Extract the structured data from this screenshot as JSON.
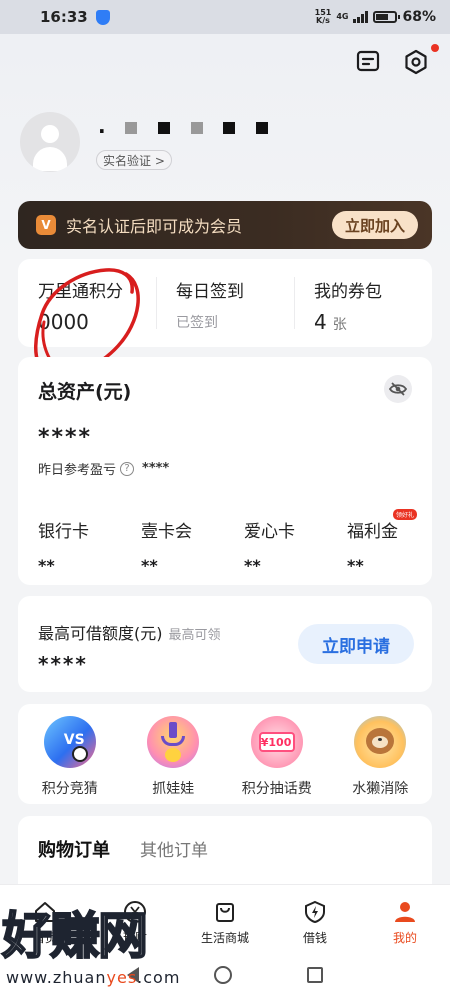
{
  "status_bar": {
    "time": "16:33",
    "net_speed": "151",
    "net_unit": "K/s",
    "net_type": "4G",
    "battery": "68%"
  },
  "header": {
    "username_masked": ". ·· . . ",
    "verify_label": "实名验证 >"
  },
  "banner": {
    "badge": "V",
    "text": "实名认证后即可成为会员",
    "button": "立即加入"
  },
  "stats": [
    {
      "label": "万里通积分",
      "value": "0000",
      "sub": ""
    },
    {
      "label": "每日签到",
      "value": "",
      "sub": "已签到"
    },
    {
      "label": "我的券包",
      "value": "4",
      "unit": "张"
    }
  ],
  "assets": {
    "title": "总资产(元)",
    "total": "****",
    "yesterday_label": "昨日参考盈亏",
    "yesterday_value": "****",
    "items": [
      {
        "label": "银行卡",
        "value": "**"
      },
      {
        "label": "壹卡会",
        "value": "**"
      },
      {
        "label": "爱心卡",
        "value": "**"
      },
      {
        "label": "福利金",
        "value": "**",
        "badge": "领好礼"
      }
    ]
  },
  "credit": {
    "title": "最高可借额度(元)",
    "subtitle": "最高可领",
    "value": "****",
    "button": "立即申请"
  },
  "games": [
    {
      "label": "积分竞猜",
      "icon": "sports-ball-icon",
      "inner": "VS"
    },
    {
      "label": "抓娃娃",
      "icon": "claw-machine-icon",
      "inner": ""
    },
    {
      "label": "积分抽话费",
      "icon": "phone-bill-coupon-icon",
      "inner": "¥100"
    },
    {
      "label": "水獭消除",
      "icon": "otter-game-icon",
      "inner": ""
    }
  ],
  "orders": {
    "tab_active": "购物订单",
    "tab_other": "其他订单"
  },
  "bottom_nav": [
    {
      "label": "首页",
      "icon": "home-icon",
      "active": false
    },
    {
      "label": "理财",
      "icon": "yuan-coin-icon",
      "active": false
    },
    {
      "label": "生活商城",
      "icon": "shopping-bag-icon",
      "active": false
    },
    {
      "label": "借钱",
      "icon": "lightning-shield-icon",
      "active": false
    },
    {
      "label": "我的",
      "icon": "person-icon",
      "active": true
    }
  ],
  "watermark": {
    "text": "好赚网",
    "url_prefix": "www.zhuan",
    "url_accent": "yes",
    "url_suffix": ".com"
  },
  "colors": {
    "accent": "#e94a1e",
    "primary_blue": "#2a6fe0",
    "banner_bg": "#3b2c22",
    "banner_text": "#f3dcc0",
    "annotation_red": "#d81e1e"
  }
}
